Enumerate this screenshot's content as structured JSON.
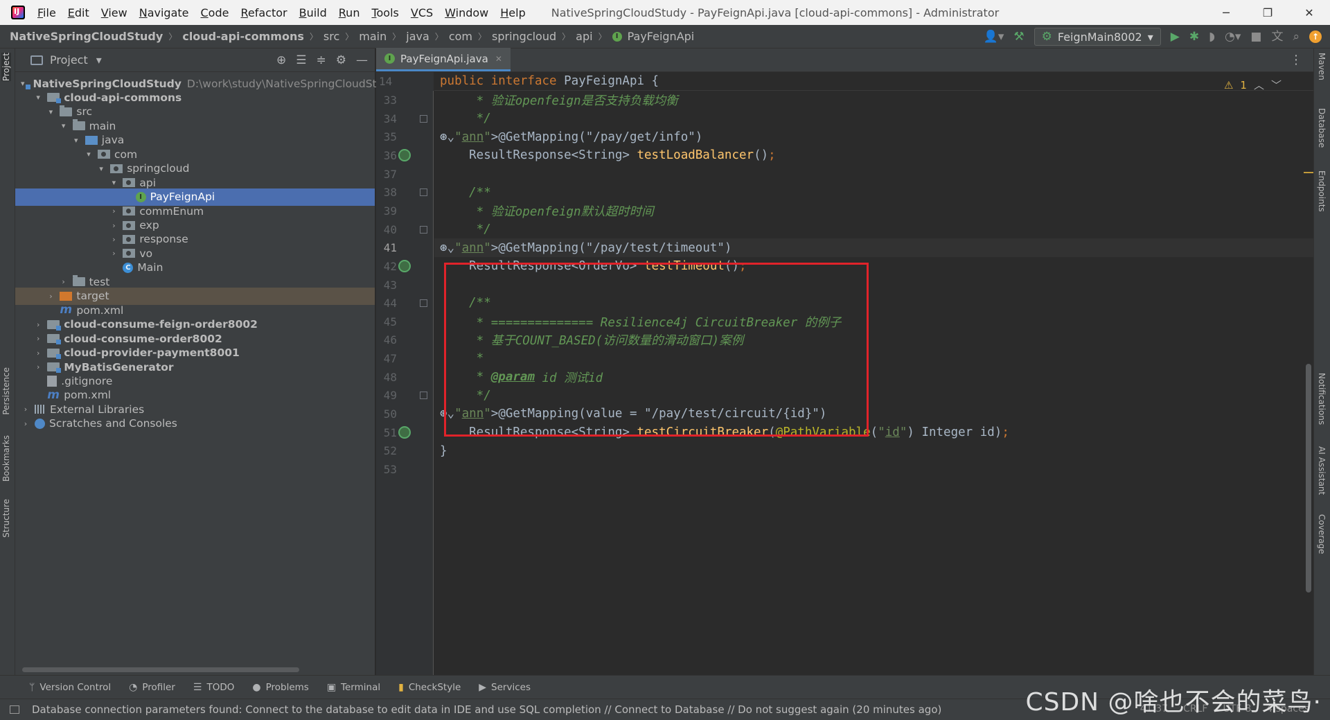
{
  "menubar": {
    "items": [
      "File",
      "Edit",
      "View",
      "Navigate",
      "Code",
      "Refactor",
      "Build",
      "Run",
      "Tools",
      "VCS",
      "Window",
      "Help"
    ],
    "window_title": "NativeSpringCloudStudy - PayFeignApi.java [cloud-api-commons] - Administrator",
    "controls": {
      "minimize": "─",
      "restore": "❐",
      "close": "✕"
    }
  },
  "navbar": {
    "crumbs": [
      "NativeSpringCloudStudy",
      "cloud-api-commons",
      "src",
      "main",
      "java",
      "com",
      "springcloud",
      "api",
      "PayFeignApi"
    ],
    "run_config": "FeignMain8002",
    "interface_glyph": "I"
  },
  "project_panel": {
    "title": "Project",
    "tree": [
      {
        "label": "NativeSpringCloudStudy",
        "hint": "D:\\work\\study\\NativeSpringCloudStu",
        "arrow": "▾",
        "icon": "module",
        "bold": true
      },
      {
        "label": "cloud-api-commons",
        "arrow": "▾",
        "icon": "module",
        "bold": true
      },
      {
        "label": "src",
        "arrow": "▾",
        "icon": "folder"
      },
      {
        "label": "main",
        "arrow": "▾",
        "icon": "folder"
      },
      {
        "label": "java",
        "arrow": "▾",
        "icon": "src"
      },
      {
        "label": "com",
        "arrow": "▾",
        "icon": "pkg"
      },
      {
        "label": "springcloud",
        "arrow": "▾",
        "icon": "pkg"
      },
      {
        "label": "api",
        "arrow": "▾",
        "icon": "pkg"
      },
      {
        "label": "PayFeignApi",
        "arrow": "",
        "icon": "iface",
        "selected": true
      },
      {
        "label": "commEnum",
        "arrow": "›",
        "icon": "pkg"
      },
      {
        "label": "exp",
        "arrow": "›",
        "icon": "pkg"
      },
      {
        "label": "response",
        "arrow": "›",
        "icon": "pkg"
      },
      {
        "label": "vo",
        "arrow": "›",
        "icon": "pkg"
      },
      {
        "label": "Main",
        "arrow": "",
        "icon": "cls"
      },
      {
        "label": "test",
        "arrow": "›",
        "icon": "folder"
      },
      {
        "label": "target",
        "arrow": "›",
        "icon": "target",
        "excluded": true
      },
      {
        "label": "pom.xml",
        "arrow": "",
        "icon": "maven"
      },
      {
        "label": "cloud-consume-feign-order8002",
        "arrow": "›",
        "icon": "module",
        "bold": true
      },
      {
        "label": "cloud-consume-order8002",
        "arrow": "›",
        "icon": "module",
        "bold": true
      },
      {
        "label": "cloud-provider-payment8001",
        "arrow": "›",
        "icon": "module",
        "bold": true
      },
      {
        "label": "MyBatisGenerator",
        "arrow": "›",
        "icon": "module",
        "bold": true
      },
      {
        "label": ".gitignore",
        "arrow": "",
        "icon": "git"
      },
      {
        "label": "pom.xml",
        "arrow": "",
        "icon": "maven"
      },
      {
        "label": "External Libraries",
        "arrow": "›",
        "icon": "lib"
      },
      {
        "label": "Scratches and Consoles",
        "arrow": "›",
        "icon": "scratch"
      }
    ]
  },
  "left_strip": [
    "Project",
    "Persistence",
    "Bookmarks",
    "Structure"
  ],
  "right_strip": [
    "Maven",
    "Database",
    "Endpoints",
    "Notifications",
    "AI Assistant",
    "Coverage"
  ],
  "editor": {
    "tab_label": "PayFeignApi.java",
    "sticky": {
      "line": "14",
      "code": "public interface PayFeignApi {"
    },
    "warnings": "1",
    "lines": [
      {
        "n": "33",
        "code": "     * 验证openfeign是否支持负载均衡"
      },
      {
        "n": "34",
        "code": "     */"
      },
      {
        "n": "35",
        "code": "    @GetMapping(\"/pay/get/info\")"
      },
      {
        "n": "36",
        "code": "    ResultResponse<String> testLoadBalancer();"
      },
      {
        "n": "37",
        "code": ""
      },
      {
        "n": "38",
        "code": "    /**"
      },
      {
        "n": "39",
        "code": "     * 验证openfeign默认超时时间"
      },
      {
        "n": "40",
        "code": "     */"
      },
      {
        "n": "41",
        "code": "    @GetMapping(\"/pay/test/timeout\")"
      },
      {
        "n": "42",
        "code": "    ResultResponse<OrderVo> testTimeout();"
      },
      {
        "n": "43",
        "code": ""
      },
      {
        "n": "44",
        "code": "    /**"
      },
      {
        "n": "45",
        "code": "     * ============== Resilience4j CircuitBreaker 的例子"
      },
      {
        "n": "46",
        "code": "     * 基于COUNT_BASED(访问数量的滑动窗口)案例"
      },
      {
        "n": "47",
        "code": "     *"
      },
      {
        "n": "48",
        "code": "     * @param id 测试id"
      },
      {
        "n": "49",
        "code": "     */"
      },
      {
        "n": "50",
        "code": "    @GetMapping(value = \"/pay/test/circuit/{id}\")"
      },
      {
        "n": "51",
        "code": "    ResultResponse<String> testCircuitBreaker(@PathVariable(\"id\") Integer id);"
      },
      {
        "n": "52",
        "code": "}"
      },
      {
        "n": "53",
        "code": ""
      }
    ]
  },
  "bottom_tools": [
    "Version Control",
    "Profiler",
    "TODO",
    "Problems",
    "Terminal",
    "CheckStyle",
    "Services"
  ],
  "status": {
    "message": "Database connection parameters found: Connect to the database to edit data in IDE and use SQL completion // Connect to Database // Do not suggest again (20 minutes ago)",
    "position": "41:37",
    "line_sep": "CRLF",
    "encoding": "UTF-8",
    "indent": "4 spaces"
  },
  "watermark": "CSDN @啥也不会的菜鸟·"
}
